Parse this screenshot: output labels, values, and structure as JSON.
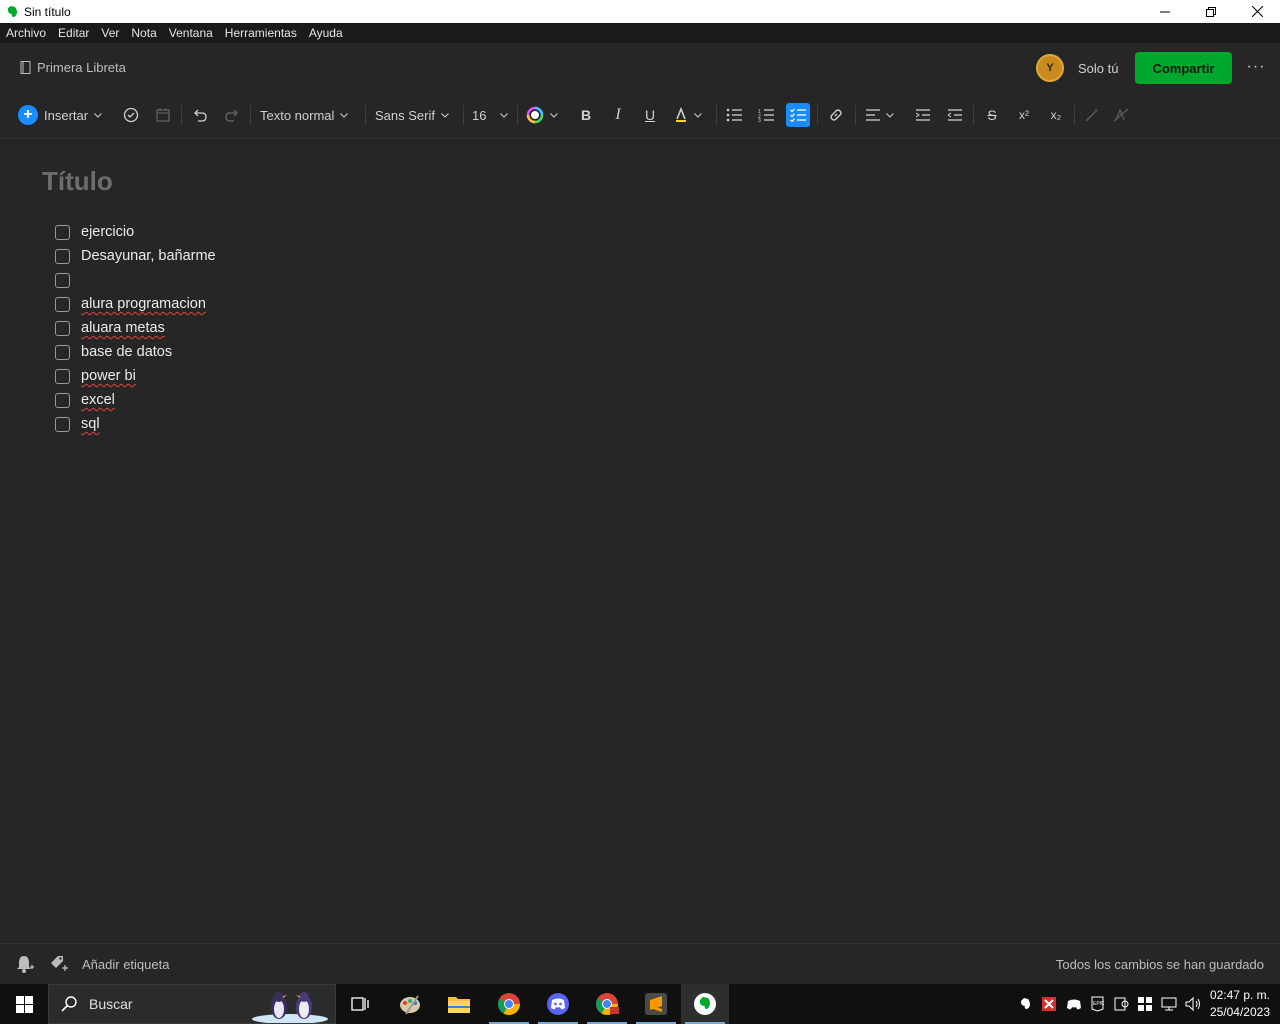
{
  "window": {
    "title": "Sin título"
  },
  "menu": [
    "Archivo",
    "Editar",
    "Ver",
    "Nota",
    "Ventana",
    "Herramientas",
    "Ayuda"
  ],
  "header": {
    "notebook": "Primera Libreta",
    "avatar_initial": "Y",
    "sharing_status": "Solo tú",
    "share_label": "Compartir",
    "more_label": "···"
  },
  "toolbar": {
    "insert_label": "Insertar",
    "text_style": "Texto normal",
    "font_family": "Sans Serif",
    "font_size": "16",
    "superscript": "x²",
    "subscript": "x₂"
  },
  "note": {
    "title_placeholder": "Título",
    "checklist": [
      {
        "text": "ejercicio",
        "checked": false,
        "misspelled": false
      },
      {
        "text": "Desayunar, bañarme",
        "checked": false,
        "misspelled": false
      },
      {
        "text": "",
        "checked": false,
        "misspelled": false
      },
      {
        "text": "alura programacion",
        "checked": false,
        "misspelled": true
      },
      {
        "text": "aluara metas",
        "checked": false,
        "misspelled": true
      },
      {
        "text": "base de datos",
        "checked": false,
        "misspelled": false
      },
      {
        "text": "power bi",
        "checked": false,
        "misspelled": true
      },
      {
        "text": "excel",
        "checked": false,
        "misspelled": true
      },
      {
        "text": "sql",
        "checked": false,
        "misspelled": true
      }
    ]
  },
  "footer": {
    "add_tag": "Añadir etiqueta",
    "save_status": "Todos los cambios se han guardado"
  },
  "taskbar": {
    "search_label": "Buscar",
    "time": "02:47 p. m.",
    "date": "25/04/2023"
  },
  "colors": {
    "accent_green": "#00a82d",
    "accent_blue": "#1a8cff",
    "background": "#262626",
    "avatar": "#c98a1e"
  }
}
